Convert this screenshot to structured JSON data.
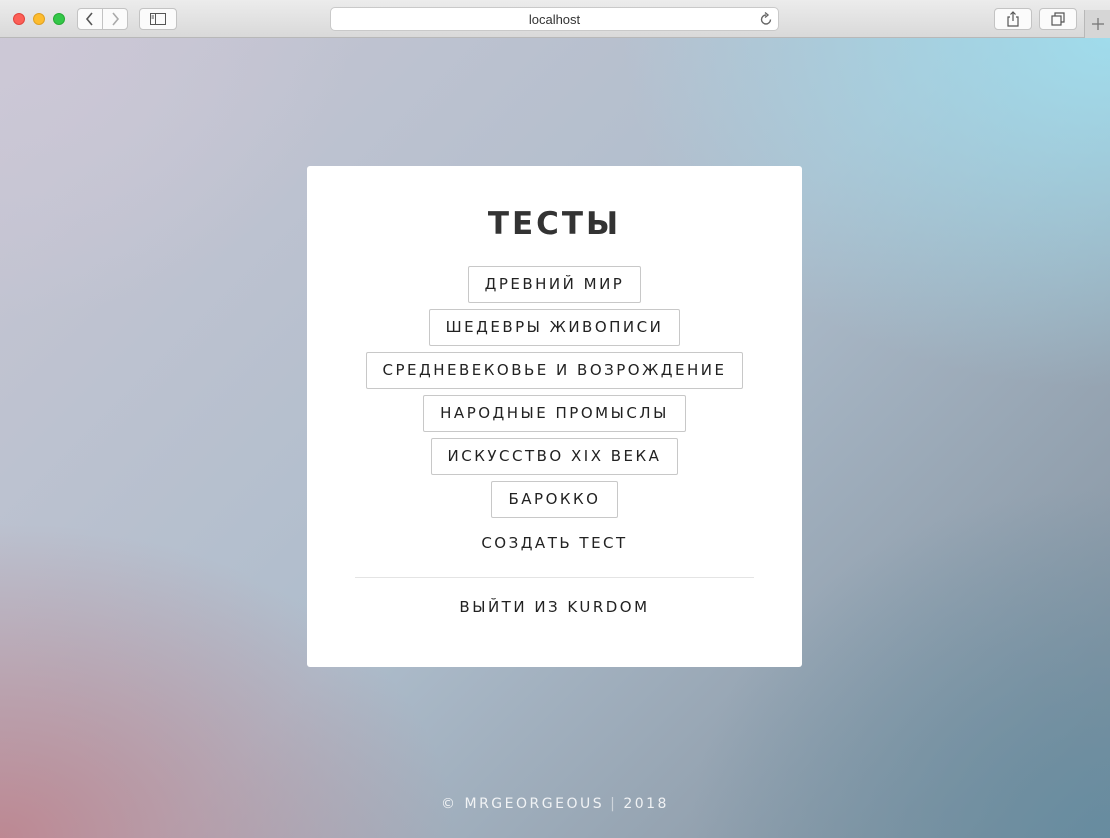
{
  "browser": {
    "url": "localhost",
    "icons": {
      "back": "chevron-left-icon",
      "forward": "chevron-right-icon",
      "sidebar": "sidebar-icon",
      "reload": "reload-icon",
      "share": "share-icon",
      "tabs": "tabs-overview-icon",
      "new_tab": "plus-icon"
    }
  },
  "card": {
    "title": "ТЕСТЫ",
    "tests": [
      "ДРЕВНИЙ МИР",
      "ШЕДЕВРЫ ЖИВОПИСИ",
      "СРЕДНЕВЕКОВЬЕ И ВОЗРОЖДЕНИЕ",
      "НАРОДНЫЕ ПРОМЫСЛЫ",
      "ИСКУССТВО XIX ВЕКА",
      "БАРОККО"
    ],
    "create_label": "СОЗДАТЬ ТЕСТ",
    "logout_label": "ВЫЙТИ ИЗ KURDOM"
  },
  "footer": {
    "copyright": "© MRGEORGEOUS",
    "separator": "|",
    "year": "2018"
  }
}
